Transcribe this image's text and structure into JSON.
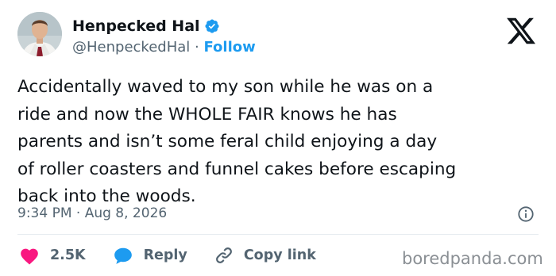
{
  "author": {
    "display_name": "Henpecked Hal",
    "handle": "@HenpeckedHal",
    "separator": "·",
    "follow_label": "Follow",
    "verified": true
  },
  "tweet": {
    "text": "Accidentally waved to my son while he was on a\nride and now the WHOLE FAIR knows he has\nparents and isn’t some feral child enjoying a day\nof roller coasters and funnel cakes before escaping\nback into the woods.",
    "timestamp": "9:34 PM · Aug 8, 2026"
  },
  "actions": {
    "like_count": "2.5K",
    "reply_label": "Reply",
    "copy_link_label": "Copy link"
  },
  "watermark": "boredpanda.com",
  "icons": {
    "platform": "x-logo-icon",
    "verified": "verified-badge-icon",
    "info": "info-icon",
    "like": "heart-icon",
    "reply": "speech-bubble-icon",
    "copy": "link-icon"
  },
  "colors": {
    "text": "#0f1419",
    "secondary": "#536471",
    "accent": "#1d9bf0",
    "like": "#f91880",
    "watermark": "#8a8f94"
  }
}
